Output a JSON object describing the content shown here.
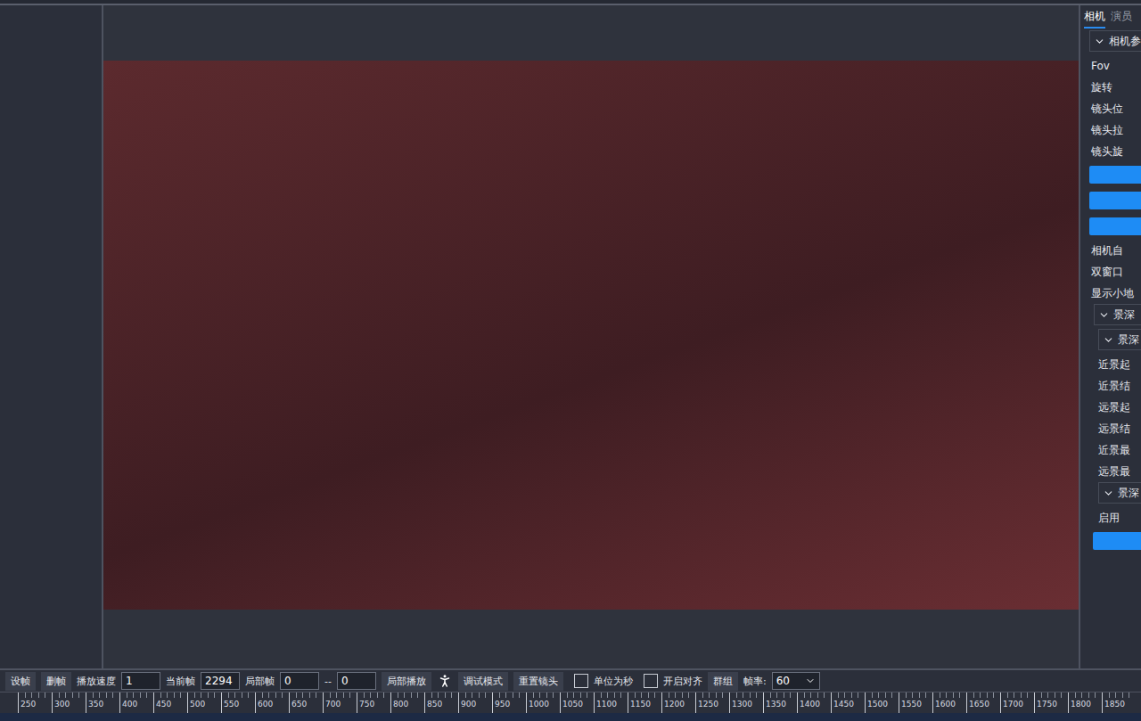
{
  "right_panel": {
    "tabs": [
      {
        "label": "相机",
        "selected": true
      },
      {
        "label": "演员",
        "selected": false
      }
    ],
    "tree": [
      {
        "kind": "section",
        "label": "相机参",
        "expanded": true,
        "depth": 0
      },
      {
        "kind": "item",
        "label": "Fov",
        "depth": 0
      },
      {
        "kind": "item",
        "label": "旋转",
        "depth": 0
      },
      {
        "kind": "item",
        "label": "镜头位",
        "depth": 0
      },
      {
        "kind": "item",
        "label": "镜头拉",
        "depth": 0
      },
      {
        "kind": "item",
        "label": "镜头旋",
        "depth": 0
      },
      {
        "kind": "button",
        "label": "",
        "depth": 0
      },
      {
        "kind": "button",
        "label": "",
        "depth": 0
      },
      {
        "kind": "button",
        "label": "",
        "depth": 0
      },
      {
        "kind": "item",
        "label": "相机自",
        "depth": 0
      },
      {
        "kind": "item",
        "label": "双窗口",
        "depth": 0
      },
      {
        "kind": "item",
        "label": "显示小地",
        "depth": 0
      },
      {
        "kind": "section",
        "label": "景深",
        "expanded": true,
        "depth": 1
      },
      {
        "kind": "section",
        "label": "景深",
        "expanded": true,
        "depth": 2
      },
      {
        "kind": "item",
        "label": "近景起",
        "depth": 2
      },
      {
        "kind": "item",
        "label": "近景结",
        "depth": 2
      },
      {
        "kind": "item",
        "label": "远景起",
        "depth": 2
      },
      {
        "kind": "item",
        "label": "远景结",
        "depth": 2
      },
      {
        "kind": "item",
        "label": "近景最",
        "depth": 2
      },
      {
        "kind": "item",
        "label": "远景最",
        "depth": 2
      },
      {
        "kind": "section",
        "label": "景深",
        "expanded": true,
        "depth": 2
      },
      {
        "kind": "item",
        "label": "启用",
        "depth": 2
      },
      {
        "kind": "button",
        "label": "",
        "depth": 1
      }
    ]
  },
  "toolbar": [
    {
      "kind": "button",
      "label": "设帧"
    },
    {
      "kind": "button",
      "label": "删帧"
    },
    {
      "kind": "label",
      "label": "播放速度"
    },
    {
      "kind": "field",
      "value": "1"
    },
    {
      "kind": "label",
      "label": "当前帧"
    },
    {
      "kind": "field",
      "value": "2294"
    },
    {
      "kind": "label",
      "label": "局部帧"
    },
    {
      "kind": "field",
      "value": "0"
    },
    {
      "kind": "label",
      "label": "--"
    },
    {
      "kind": "field",
      "value": "0"
    },
    {
      "kind": "button",
      "label": "局部播放"
    },
    {
      "kind": "icon",
      "label": ""
    },
    {
      "kind": "button",
      "label": "调试模式"
    },
    {
      "kind": "button",
      "label": "重置镜头"
    },
    {
      "kind": "checkbox",
      "label": "单位为秒",
      "checked": false
    },
    {
      "kind": "checkbox",
      "label": "开启对齐",
      "checked": false
    },
    {
      "kind": "button",
      "label": "群组"
    },
    {
      "kind": "label",
      "label": "帧率:"
    },
    {
      "kind": "select",
      "value": "60"
    }
  ],
  "ruler": {
    "ticks": [
      "250",
      "300",
      "350",
      "400",
      "450",
      "500",
      "550",
      "600",
      "650",
      "700",
      "750",
      "800",
      "850",
      "900",
      "950",
      "1000",
      "1050",
      "1100",
      "1150",
      "1200",
      "1250",
      "1300",
      "1350",
      "1400",
      "1450",
      "1500",
      "1550",
      "1600",
      "1650",
      "1700",
      "1750",
      "1800",
      "1850"
    ]
  }
}
